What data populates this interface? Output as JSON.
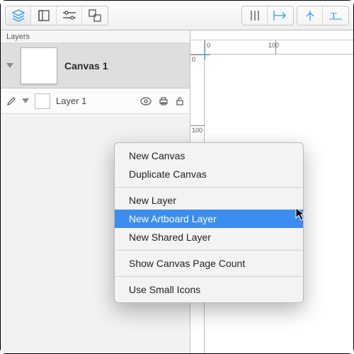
{
  "toolbar": {
    "icons": [
      "layers-panel",
      "artboard-panel",
      "sliders-panel",
      "outline-panel"
    ],
    "icons_right": [
      "columns-guide",
      "align-left-guide",
      "align-center-guide",
      "baseline-guide"
    ]
  },
  "sidebar": {
    "title": "Layers",
    "canvas": {
      "name": "Canvas 1"
    },
    "layer": {
      "name": "Layer 1"
    }
  },
  "ruler": {
    "h": [
      "0",
      "100"
    ],
    "v": [
      "0",
      "100"
    ]
  },
  "menu": {
    "items": [
      "New Canvas",
      "Duplicate Canvas",
      "New Layer",
      "New Artboard Layer",
      "New Shared Layer",
      "Show Canvas Page Count",
      "Use Small Icons"
    ],
    "highlight_index": 3
  }
}
